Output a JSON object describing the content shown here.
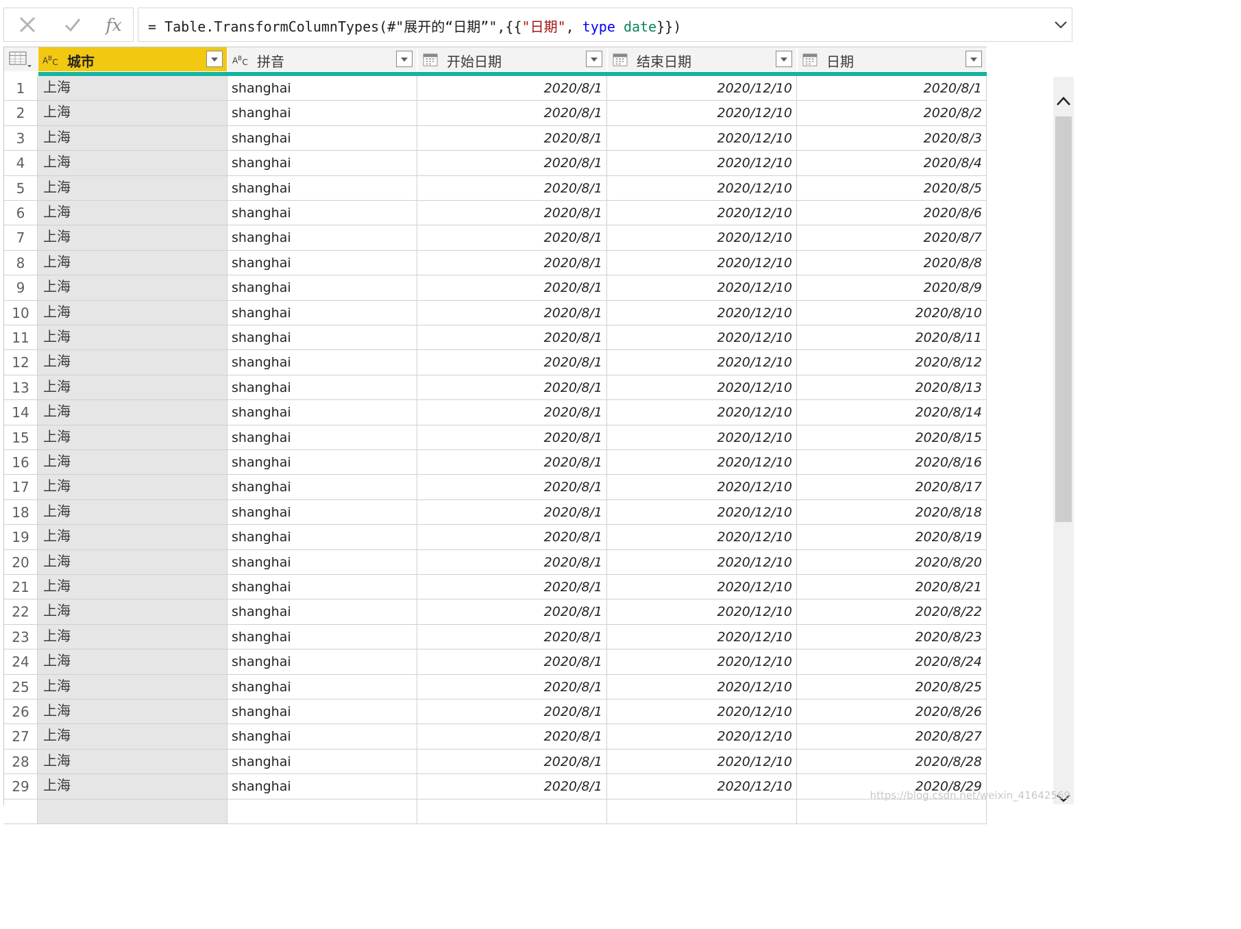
{
  "formula_bar": {
    "cancel_icon": "close-icon",
    "commit_icon": "check-icon",
    "fx_label": "fx",
    "code_prefix": "= Table.TransformColumnTypes(#\"展开的“日期”\",{{",
    "code_string": "\"日期\"",
    "code_sep": ", ",
    "code_keyword": "type",
    "code_space": " ",
    "code_type": "date",
    "code_suffix": "}})"
  },
  "columns": [
    {
      "name": "城市",
      "type_icon": "text-type-icon",
      "selected": true
    },
    {
      "name": "拼音",
      "type_icon": "text-type-icon",
      "selected": false
    },
    {
      "name": "开始日期",
      "type_icon": "date-type-icon",
      "selected": false
    },
    {
      "name": "结束日期",
      "type_icon": "date-type-icon",
      "selected": false
    },
    {
      "name": "日期",
      "type_icon": "date-type-icon",
      "selected": false
    }
  ],
  "type_badge": {
    "a": "A",
    "b": "B",
    "c": "C"
  },
  "rows": [
    {
      "n": "1",
      "city": "上海",
      "pinyin": "shanghai",
      "start": "2020/8/1",
      "end": "2020/12/10",
      "date": "2020/8/1"
    },
    {
      "n": "2",
      "city": "上海",
      "pinyin": "shanghai",
      "start": "2020/8/1",
      "end": "2020/12/10",
      "date": "2020/8/2"
    },
    {
      "n": "3",
      "city": "上海",
      "pinyin": "shanghai",
      "start": "2020/8/1",
      "end": "2020/12/10",
      "date": "2020/8/3"
    },
    {
      "n": "4",
      "city": "上海",
      "pinyin": "shanghai",
      "start": "2020/8/1",
      "end": "2020/12/10",
      "date": "2020/8/4"
    },
    {
      "n": "5",
      "city": "上海",
      "pinyin": "shanghai",
      "start": "2020/8/1",
      "end": "2020/12/10",
      "date": "2020/8/5"
    },
    {
      "n": "6",
      "city": "上海",
      "pinyin": "shanghai",
      "start": "2020/8/1",
      "end": "2020/12/10",
      "date": "2020/8/6"
    },
    {
      "n": "7",
      "city": "上海",
      "pinyin": "shanghai",
      "start": "2020/8/1",
      "end": "2020/12/10",
      "date": "2020/8/7"
    },
    {
      "n": "8",
      "city": "上海",
      "pinyin": "shanghai",
      "start": "2020/8/1",
      "end": "2020/12/10",
      "date": "2020/8/8"
    },
    {
      "n": "9",
      "city": "上海",
      "pinyin": "shanghai",
      "start": "2020/8/1",
      "end": "2020/12/10",
      "date": "2020/8/9"
    },
    {
      "n": "10",
      "city": "上海",
      "pinyin": "shanghai",
      "start": "2020/8/1",
      "end": "2020/12/10",
      "date": "2020/8/10"
    },
    {
      "n": "11",
      "city": "上海",
      "pinyin": "shanghai",
      "start": "2020/8/1",
      "end": "2020/12/10",
      "date": "2020/8/11"
    },
    {
      "n": "12",
      "city": "上海",
      "pinyin": "shanghai",
      "start": "2020/8/1",
      "end": "2020/12/10",
      "date": "2020/8/12"
    },
    {
      "n": "13",
      "city": "上海",
      "pinyin": "shanghai",
      "start": "2020/8/1",
      "end": "2020/12/10",
      "date": "2020/8/13"
    },
    {
      "n": "14",
      "city": "上海",
      "pinyin": "shanghai",
      "start": "2020/8/1",
      "end": "2020/12/10",
      "date": "2020/8/14"
    },
    {
      "n": "15",
      "city": "上海",
      "pinyin": "shanghai",
      "start": "2020/8/1",
      "end": "2020/12/10",
      "date": "2020/8/15"
    },
    {
      "n": "16",
      "city": "上海",
      "pinyin": "shanghai",
      "start": "2020/8/1",
      "end": "2020/12/10",
      "date": "2020/8/16"
    },
    {
      "n": "17",
      "city": "上海",
      "pinyin": "shanghai",
      "start": "2020/8/1",
      "end": "2020/12/10",
      "date": "2020/8/17"
    },
    {
      "n": "18",
      "city": "上海",
      "pinyin": "shanghai",
      "start": "2020/8/1",
      "end": "2020/12/10",
      "date": "2020/8/18"
    },
    {
      "n": "19",
      "city": "上海",
      "pinyin": "shanghai",
      "start": "2020/8/1",
      "end": "2020/12/10",
      "date": "2020/8/19"
    },
    {
      "n": "20",
      "city": "上海",
      "pinyin": "shanghai",
      "start": "2020/8/1",
      "end": "2020/12/10",
      "date": "2020/8/20"
    },
    {
      "n": "21",
      "city": "上海",
      "pinyin": "shanghai",
      "start": "2020/8/1",
      "end": "2020/12/10",
      "date": "2020/8/21"
    },
    {
      "n": "22",
      "city": "上海",
      "pinyin": "shanghai",
      "start": "2020/8/1",
      "end": "2020/12/10",
      "date": "2020/8/22"
    },
    {
      "n": "23",
      "city": "上海",
      "pinyin": "shanghai",
      "start": "2020/8/1",
      "end": "2020/12/10",
      "date": "2020/8/23"
    },
    {
      "n": "24",
      "city": "上海",
      "pinyin": "shanghai",
      "start": "2020/8/1",
      "end": "2020/12/10",
      "date": "2020/8/24"
    },
    {
      "n": "25",
      "city": "上海",
      "pinyin": "shanghai",
      "start": "2020/8/1",
      "end": "2020/12/10",
      "date": "2020/8/25"
    },
    {
      "n": "26",
      "city": "上海",
      "pinyin": "shanghai",
      "start": "2020/8/1",
      "end": "2020/12/10",
      "date": "2020/8/26"
    },
    {
      "n": "27",
      "city": "上海",
      "pinyin": "shanghai",
      "start": "2020/8/1",
      "end": "2020/12/10",
      "date": "2020/8/27"
    },
    {
      "n": "28",
      "city": "上海",
      "pinyin": "shanghai",
      "start": "2020/8/1",
      "end": "2020/12/10",
      "date": "2020/8/28"
    },
    {
      "n": "29",
      "city": "上海",
      "pinyin": "shanghai",
      "start": "2020/8/1",
      "end": "2020/12/10",
      "date": "2020/8/29"
    },
    {
      "n": "",
      "city": "",
      "pinyin": "",
      "start": "",
      "end": "",
      "date": ""
    }
  ],
  "watermark": "https://blog.csdn.net/weixin_41642569",
  "colors": {
    "selected_header": "#f2c811",
    "quality_bar": "#17b3a0",
    "key_column_bg": "#e6e6e6"
  }
}
